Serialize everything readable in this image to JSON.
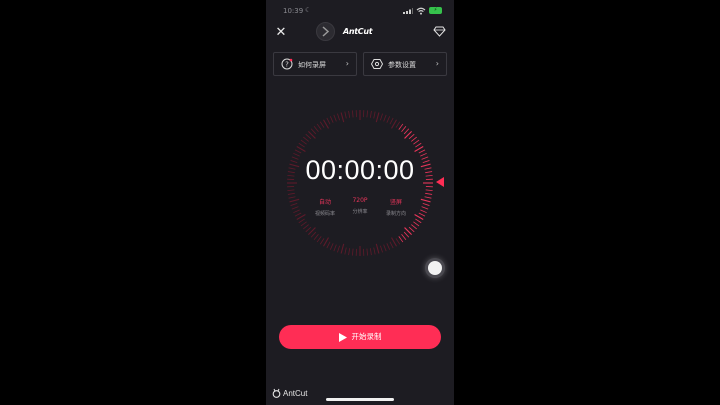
{
  "status_bar": {
    "time": "10:39"
  },
  "header": {
    "brand": "AntCut"
  },
  "cards": [
    {
      "label": "如何录屏",
      "icon": "question-icon"
    },
    {
      "label": "参数设置",
      "icon": "settings-icon"
    }
  ],
  "timer": {
    "display": "00:00:00"
  },
  "meta": [
    {
      "value": "自动",
      "label": "视频码率"
    },
    {
      "value": "720P",
      "label": "分辨率"
    },
    {
      "value": "竖屏",
      "label": "录制方向"
    }
  ],
  "start_button": {
    "label": "开始录制"
  },
  "watermark": {
    "text": "AntCut"
  },
  "colors": {
    "accent": "#ff2d55",
    "background": "#1d1c22",
    "tick_dim": "#5e1a2a",
    "tick_bright": "#e8355a"
  }
}
